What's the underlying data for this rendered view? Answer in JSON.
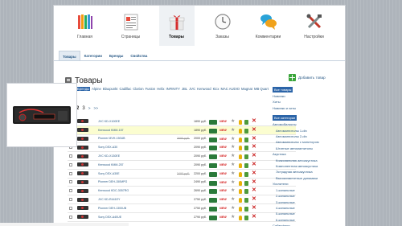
{
  "nav": [
    {
      "label": "Главная",
      "icon": "books-icon",
      "active": false
    },
    {
      "label": "Страницы",
      "icon": "pages-icon",
      "active": false
    },
    {
      "label": "Товары",
      "icon": "gift-icon",
      "active": true
    },
    {
      "label": "Заказы",
      "icon": "clock-icon",
      "active": false
    },
    {
      "label": "Комментарии",
      "icon": "chat-icon",
      "active": false
    },
    {
      "label": "Настройки",
      "icon": "tools-icon",
      "active": false
    }
  ],
  "subtabs": [
    "Товары",
    "Категории",
    "Бренды",
    "Свойства"
  ],
  "page": {
    "title": "Товары",
    "add_label": "Добавить товар"
  },
  "brands": [
    "Бренды",
    "Alpine",
    "Blaupunkt",
    "Cadillac",
    "Clarion",
    "Fusion",
    "Helix",
    "INFINITY",
    "JBL",
    "JVC",
    "Kenwood",
    "Kicx",
    "MAC AUDIO",
    "Magnat",
    "MB Quart",
    "Mystery",
    "Phillips",
    "Pioneer",
    "Prology",
    "Sony",
    "StarLine",
    "Supra"
  ],
  "pager": {
    "current": "2",
    "next": "3",
    "more": ">",
    "last": ">>"
  },
  "products": [
    {
      "name": "JVC KD-X100EE",
      "old": "",
      "price": "1890 руб."
    },
    {
      "name": "Kenwood KMM-157",
      "old": "",
      "price": "1890 руб.",
      "highlight": true
    },
    {
      "name": "Pioneer MVH-150UB",
      "old": "2690 руб.",
      "price": "2000 руб."
    },
    {
      "name": "Sony DSX-A30",
      "old": "",
      "price": "2090 руб."
    },
    {
      "name": "JVC KD-X130EE",
      "old": "",
      "price": "2090 руб."
    },
    {
      "name": "Kenwood KMM-257",
      "old": "",
      "price": "2090 руб."
    },
    {
      "name": "Sony DSX-A30E",
      "old": "3490 руб.",
      "price": "2200 руб."
    },
    {
      "name": "Pioneer DEH-150MPG",
      "old": "",
      "price": "2490 руб."
    },
    {
      "name": "Kenwood KDC-3057RG",
      "old": "",
      "price": "2690 руб."
    },
    {
      "name": "JVC KD-R441EY",
      "old": "",
      "price": "2750 руб."
    },
    {
      "name": "Pioneer DEH-1300UB",
      "old": "",
      "price": "2750 руб."
    },
    {
      "name": "Sony DSX-A40UE",
      "old": "",
      "price": "2790 руб."
    }
  ],
  "sidebar": {
    "brands_header": "Все товары",
    "filters": [
      "Новинки",
      "Хиты",
      "Новинки и хиты"
    ],
    "cat_header": "Все категории",
    "cats": [
      {
        "label": "Автомобилисты",
        "level": 0
      },
      {
        "label": "Автомагнитолы 1-din",
        "level": 1
      },
      {
        "label": "Автомагнитолы 2-din",
        "level": 1
      },
      {
        "label": "Автомагнитолы с монитором",
        "level": 1
      },
      {
        "label": "Штатные автомагнитолы",
        "level": 1
      },
      {
        "label": "Акустика",
        "level": 0
      },
      {
        "label": "Коаксиальная автоакустика",
        "level": 1
      },
      {
        "label": "Компонентная автоакустика",
        "level": 1
      },
      {
        "label": "Эстрадная автоакустика",
        "level": 1
      },
      {
        "label": "Высокочастотные динамики",
        "level": 1
      },
      {
        "label": "Усилители",
        "level": 0
      },
      {
        "label": "1-канальные",
        "level": 1
      },
      {
        "label": "2-канальные",
        "level": 1
      },
      {
        "label": "3-канальные",
        "level": 1
      },
      {
        "label": "4-канальные",
        "level": 1
      },
      {
        "label": "5-канальные",
        "level": 1
      },
      {
        "label": "6-канальные",
        "level": 1
      },
      {
        "label": "Сабвуферы",
        "level": 0
      }
    ]
  },
  "colors": {
    "accent": "#2b64a8",
    "highlight_row": "#fbfdd0",
    "delete": "#c91d1d",
    "new_badge": "#d42020"
  }
}
